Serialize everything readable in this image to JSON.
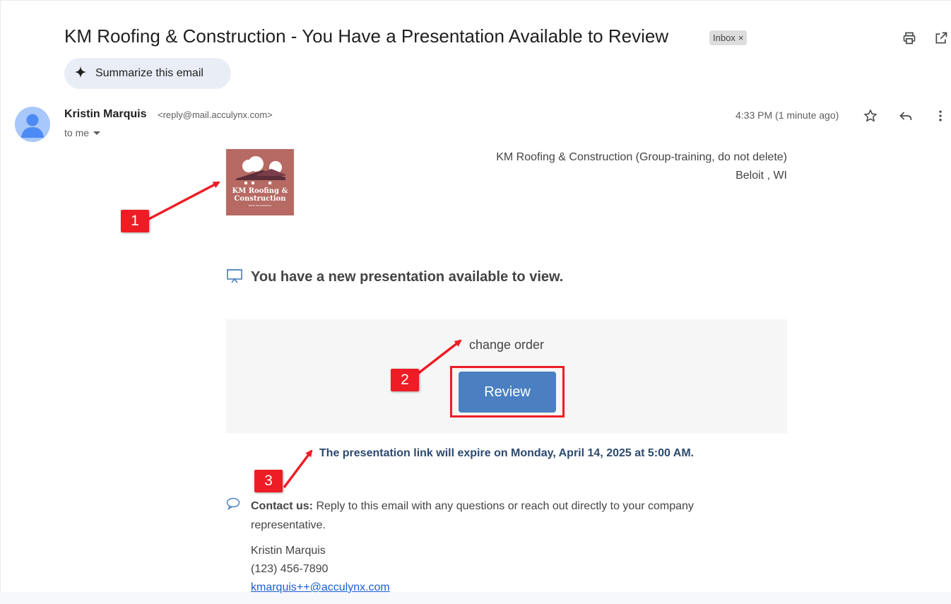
{
  "email": {
    "subject": "KM Roofing & Construction - You Have a Presentation Available to Review",
    "label_chip": "Inbox",
    "label_chip_close": "×",
    "summarize_label": "Summarize this email",
    "sender_name": "Kristin Marquis",
    "sender_email": "<reply@mail.acculynx.com>",
    "recipient_label": "to me",
    "timestamp": "4:33 PM (1 minute ago)"
  },
  "body": {
    "logo_line1": "KM Roofing &",
    "logo_line2": "Construction",
    "logo_tagline": "BEST OF ROOFING",
    "company_name": "KM Roofing & Construction (Group-training, do not delete)",
    "company_location": "Beloit , WI",
    "presentation_heading": "You have a new presentation available to view.",
    "document_title": "change order",
    "review_button": "Review",
    "expiration_notice": "The presentation link will expire on Monday, April 14, 2025 at 5:00 AM.",
    "contact_label": "Contact us:",
    "contact_text": " Reply to this email with any questions or reach out directly to your company representative.",
    "signature_name": "Kristin Marquis",
    "signature_phone": "(123) 456-7890",
    "signature_email": "kmarquis++@acculynx.com"
  },
  "annotations": [
    {
      "label": "1"
    },
    {
      "label": "2"
    },
    {
      "label": "3"
    }
  ],
  "icons": {
    "print": "print-icon",
    "open_new_window": "open-in-new-window-icon",
    "sparkle": "sparkle-icon",
    "star": "star-icon",
    "reply": "reply-icon",
    "more": "more-vertical-icon",
    "presentation": "presentation-icon",
    "chat": "chat-bubble-icon"
  },
  "colors": {
    "accent_button": "#4a7fc1",
    "annotation_red": "#ee1c25",
    "logo_background": "#b66a63",
    "link": "#1a5fd1",
    "expiration_text": "#2c4a6e"
  }
}
